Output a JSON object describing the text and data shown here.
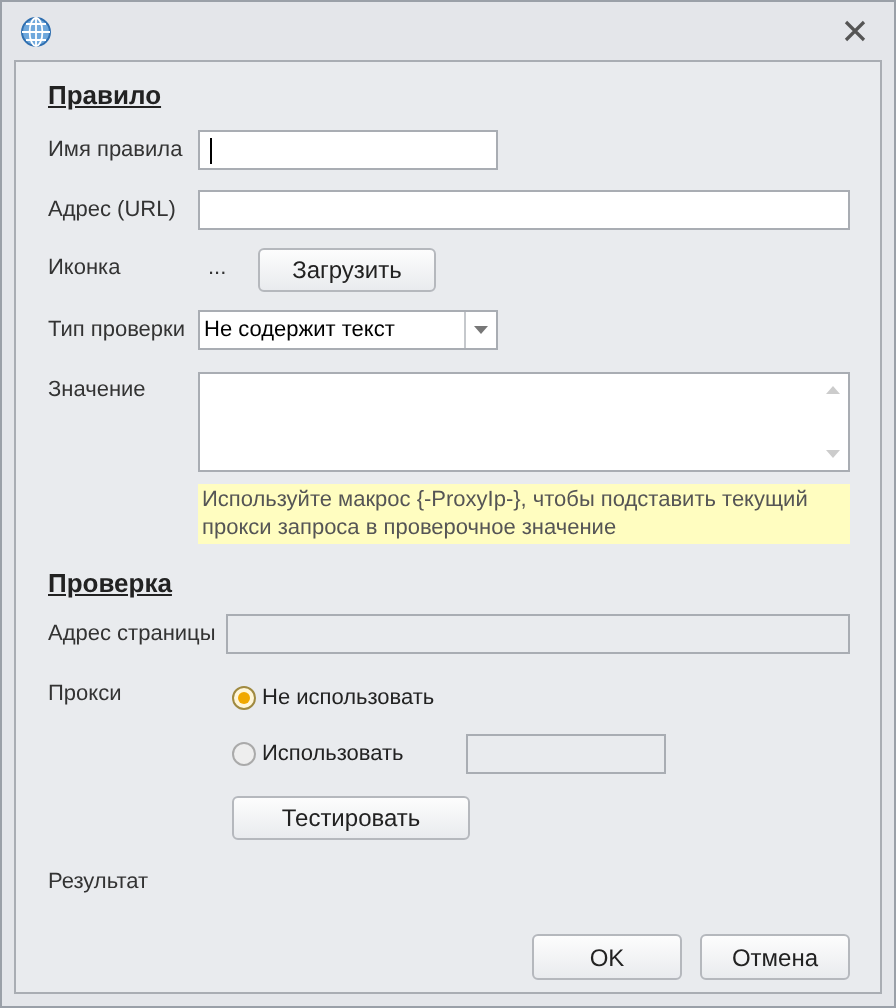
{
  "rule": {
    "heading": "Правило",
    "name_label": "Имя правила",
    "url_label": "Адрес (URL)",
    "icon_label": "Иконка",
    "icon_value": "...",
    "load_button": "Загрузить",
    "check_type_label": "Тип проверки",
    "check_type_value": "Не содержит текст",
    "value_label": "Значение",
    "hint": "Используйте макрос {-ProxyIp-}, чтобы подставить текущий прокси запроса в проверочное значение"
  },
  "test": {
    "heading": "Проверка",
    "page_url_label": "Адрес страницы",
    "page_url_disabled": true,
    "proxy_label": "Прокси",
    "proxy_options": [
      {
        "label": "Не использовать",
        "selected": true
      },
      {
        "label": "Использовать",
        "selected": false
      }
    ],
    "test_button": "Тестировать",
    "result_label": "Результат"
  },
  "buttons": [
    "OK",
    "Отмена"
  ]
}
